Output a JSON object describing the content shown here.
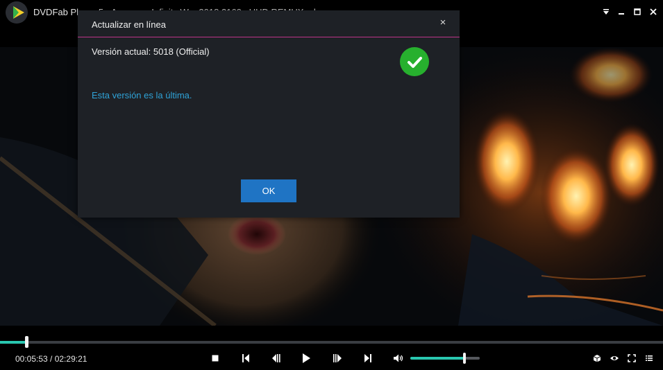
{
  "app": {
    "title": "DVDFab Player 5 - Avengers Infinity War 2018 2160p UHD REMUX.mkv"
  },
  "window_controls": {
    "menu_icon": "dropdown-triangle-icon",
    "minimize_icon": "minimize-icon",
    "maximize_icon": "maximize-icon",
    "close_icon": "close-icon"
  },
  "dialog": {
    "title": "Actualizar en línea",
    "close_label": "×",
    "version_text": "Versión actual: 5018 (Official)",
    "status_text": "Esta versión es la última.",
    "ok_label": "OK",
    "status_icon": "checkmark-icon"
  },
  "player": {
    "time_text": "00:05:53 / 02:29:21",
    "elapsed": "00:05:53",
    "duration": "02:29:21",
    "progress_fraction": 0.0394,
    "volume_fraction": 0.78,
    "buttons": [
      "stop-icon",
      "previous-chapter-icon",
      "step-back-icon",
      "play-icon",
      "step-forward-icon",
      "next-chapter-icon",
      "volume-icon",
      "3d-cube-icon",
      "eye-icon",
      "fullscreen-icon",
      "playlist-icon"
    ]
  },
  "colors": {
    "accent": "#29c7b0",
    "dialog_bg": "#1e2126",
    "header_divider": "#c0358a",
    "status_text": "#2fa3d8",
    "ok_button": "#1f74c4",
    "check_green": "#27b02e"
  }
}
